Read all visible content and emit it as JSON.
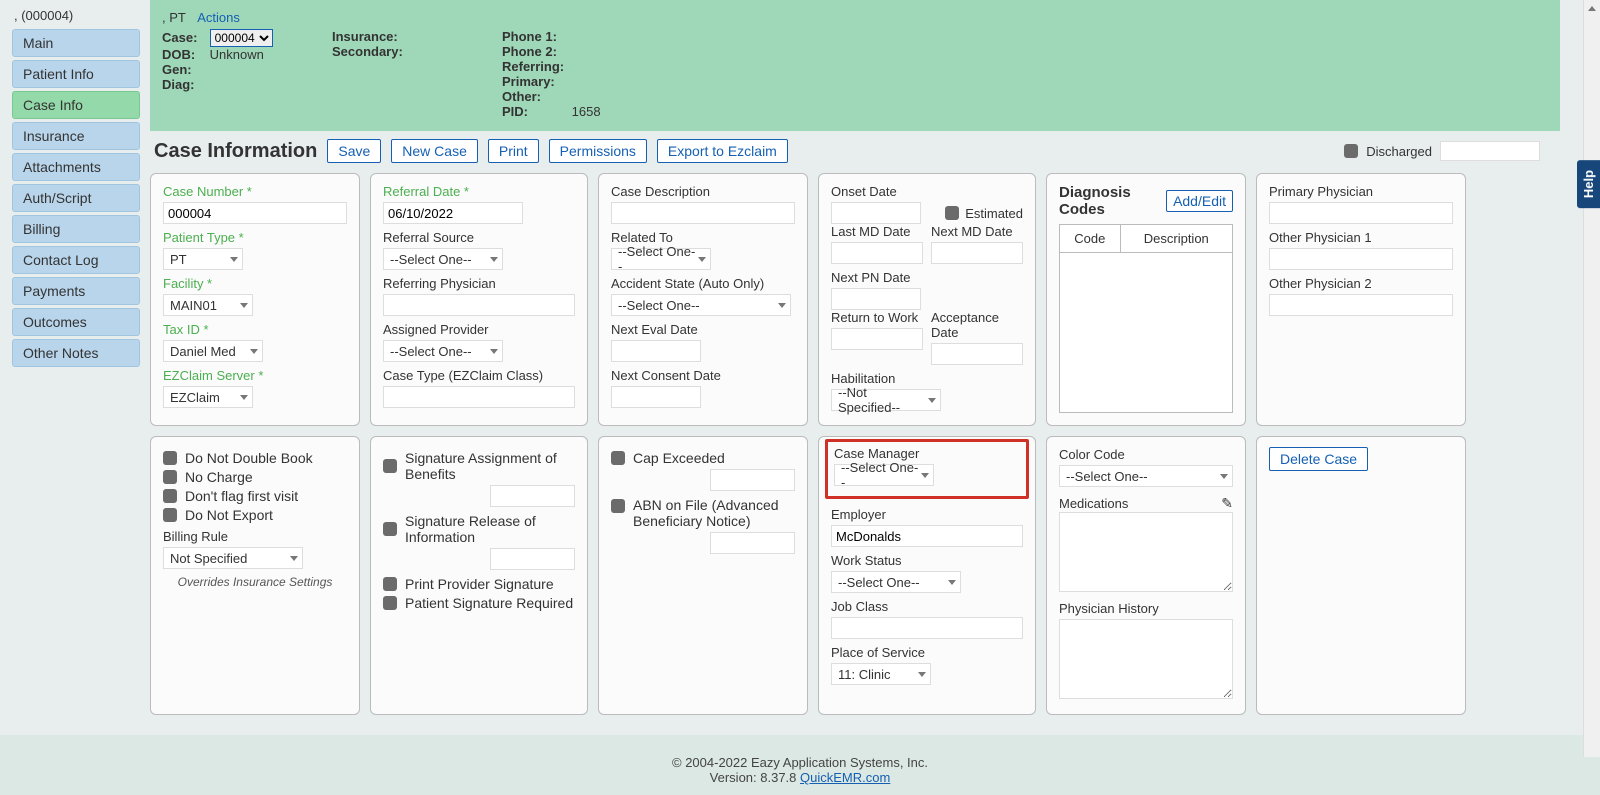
{
  "sidebar": {
    "title": ", (000004)",
    "items": [
      {
        "label": "Main"
      },
      {
        "label": "Patient Info"
      },
      {
        "label": "Case Info",
        "active": true
      },
      {
        "label": "Insurance"
      },
      {
        "label": "Attachments"
      },
      {
        "label": "Auth/Script"
      },
      {
        "label": "Billing"
      },
      {
        "label": "Contact Log"
      },
      {
        "label": "Payments"
      },
      {
        "label": "Outcomes"
      },
      {
        "label": "Other Notes"
      }
    ]
  },
  "banner": {
    "pt_label": ",   PT",
    "actions": "Actions",
    "case_label": "Case:",
    "case_value": "000004",
    "dob_label": "DOB:",
    "dob_value": "Unknown",
    "gen_label": "Gen:",
    "diag_label": "Diag:",
    "insurance_label": "Insurance:",
    "secondary_label": "Secondary:",
    "phone1_label": "Phone 1:",
    "phone2_label": "Phone 2:",
    "referring_label": "Referring:",
    "primary_label": "Primary:",
    "other_label": "Other:",
    "pid_label": "PID:",
    "pid_value": "1658"
  },
  "page": {
    "title": "Case Information",
    "buttons": {
      "save": "Save",
      "newcase": "New Case",
      "print": "Print",
      "permissions": "Permissions",
      "export": "Export to Ezclaim"
    },
    "discharged_label": "Discharged"
  },
  "card1": {
    "case_number_lbl": "Case Number *",
    "case_number_val": "000004",
    "patient_type_lbl": "Patient Type *",
    "patient_type_val": "PT",
    "facility_lbl": "Facility *",
    "facility_val": "MAIN01",
    "taxid_lbl": "Tax ID *",
    "taxid_val": "Daniel Med",
    "ezserver_lbl": "EZClaim Server *",
    "ezserver_val": "EZClaim"
  },
  "card2": {
    "refdate_lbl": "Referral Date *",
    "refdate_val": "06/10/2022",
    "refsource_lbl": "Referral Source",
    "refsource_val": "--Select One--",
    "refphys_lbl": "Referring Physician",
    "assigned_lbl": "Assigned Provider",
    "assigned_val": "--Select One--",
    "casetype_lbl": "Case Type (EZClaim Class)"
  },
  "card3": {
    "desc_lbl": "Case Description",
    "related_lbl": "Related To",
    "related_val": "--Select One--",
    "accstate_lbl": "Accident State (Auto Only)",
    "accstate_val": "--Select One--",
    "nexteval_lbl": "Next Eval Date",
    "nextconsent_lbl": "Next Consent Date"
  },
  "card4": {
    "onset_lbl": "Onset Date",
    "estimated_lbl": "Estimated",
    "lastmd_lbl": "Last MD Date",
    "nextmd_lbl": "Next MD Date",
    "nextpn_lbl": "Next PN Date",
    "rtw_lbl": "Return to Work",
    "accdate_lbl": "Acceptance Date",
    "habil_lbl": "Habilitation",
    "habil_val": "--Not Specified--"
  },
  "card5": {
    "title": "Diagnosis Codes",
    "addedit": "Add/Edit",
    "code_hdr": "Code",
    "desc_hdr": "Description"
  },
  "card6": {
    "pp_lbl": "Primary Physician",
    "op1_lbl": "Other Physician 1",
    "op2_lbl": "Other Physician 2"
  },
  "card7": {
    "dndb": "Do Not Double Book",
    "nocharge": "No Charge",
    "noflag": "Don't flag first visit",
    "noexport": "Do Not Export",
    "billing_lbl": "Billing Rule",
    "billing_val": "Not Specified",
    "overrides": "Overrides Insurance Settings"
  },
  "card8": {
    "sig_ab": "Signature Assignment of Benefits",
    "sig_roi": "Signature Release of Information",
    "print_sig": "Print Provider Signature",
    "pat_sig": "Patient Signature Required"
  },
  "card9": {
    "cap": "Cap Exceeded",
    "abn": "ABN on File (Advanced Beneficiary Notice)"
  },
  "card10": {
    "cm_lbl": "Case Manager",
    "cm_val": "--Select One--",
    "emp_lbl": "Employer",
    "emp_val": "McDonalds",
    "ws_lbl": "Work Status",
    "ws_val": "--Select One--",
    "jc_lbl": "Job Class",
    "pos_lbl": "Place of Service",
    "pos_val": "11: Clinic"
  },
  "card11": {
    "cc_lbl": "Color Code",
    "cc_val": "--Select One--",
    "med_lbl": "Medications",
    "ph_lbl": "Physician History"
  },
  "card12": {
    "delete": "Delete Case"
  },
  "footer": {
    "copyright": "© 2004-2022 Eazy Application Systems, Inc.",
    "version_prefix": "Version: 8.37.8 ",
    "link": "QuickEMR.com"
  },
  "help": "Help"
}
